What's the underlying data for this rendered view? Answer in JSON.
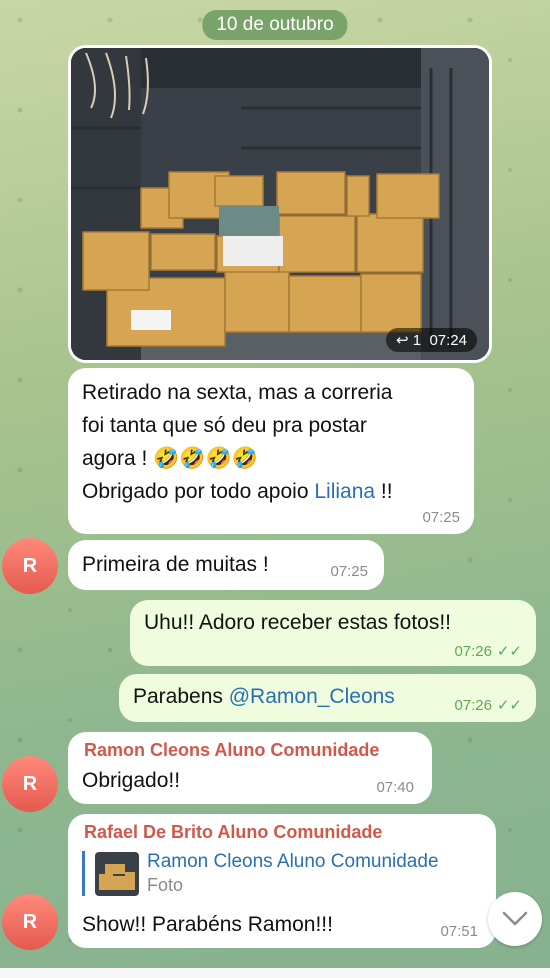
{
  "date_label": "10 de outubro",
  "photo_message": {
    "reply_count": "1",
    "time": "07:24"
  },
  "msg1": {
    "lines": [
      "Retirado na sexta, mas a correria",
      "foi tanta que só deu pra postar",
      "agora ! 🤣🤣🤣🤣"
    ],
    "last_line_prefix": "Obrigado por todo apoio ",
    "mention": "Liliana",
    "last_line_suffix": " !!",
    "time": "07:25"
  },
  "msg2": {
    "avatar": "R",
    "text": "Primeira de muitas !",
    "time": "07:25"
  },
  "msg3": {
    "text": "Uhu!! Adoro receber estas fotos!!",
    "time": "07:26"
  },
  "msg4": {
    "prefix": "Parabens ",
    "mention": "@Ramon_Cleons",
    "time": "07:26"
  },
  "msg5": {
    "avatar": "R",
    "sender": "Ramon Cleons Aluno Comunidade",
    "text": "Obrigado!!",
    "time": "07:40"
  },
  "msg6": {
    "avatar": "R",
    "sender": "Rafael De Brito Aluno Comunidade",
    "reply_sender": "Ramon Cleons Aluno Comunidade",
    "reply_type": "Foto",
    "text": "Show!! Parabéns Ramon!!!",
    "time": "07:51"
  },
  "colors": {
    "sender": "#d2584b",
    "mention": "#2a6fb5",
    "check": "#5eaa52"
  }
}
